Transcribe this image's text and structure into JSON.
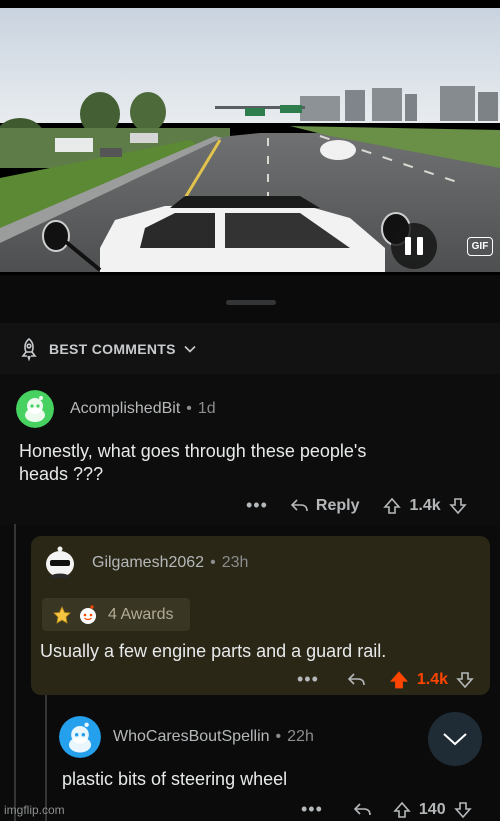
{
  "media": {
    "type": "gif",
    "gif_badge": "GIF",
    "pause_icon": "pause-icon"
  },
  "sort": {
    "label": "BEST COMMENTS",
    "icon": "rocket-icon"
  },
  "comments": [
    {
      "author": "AcomplishedBit",
      "age": "1d",
      "separator": "•",
      "body_line1": "Honestly, what goes through these people's",
      "body_line2": "heads ???",
      "more": "•••",
      "reply_label": "Reply",
      "score": "1.4k",
      "avatar_color": "#46d160"
    },
    {
      "author": "Gilgamesh2062",
      "age": "23h",
      "separator": "•",
      "awards_label": "4 Awards",
      "body": "Usually a few engine parts and a guard rail.",
      "more": "•••",
      "score": "1.4k",
      "upvoted": true,
      "upvote_color": "#ff4500",
      "score_color": "#ff4500"
    },
    {
      "author": "WhoCaresBoutSpellin",
      "age": "22h",
      "separator": "•",
      "body": "plastic bits of steering wheel",
      "more": "•••",
      "score": "140",
      "avatar_color": "#24a0ed"
    }
  ],
  "watermark": "imgflip.com",
  "colors": {
    "background": "#0b0b0b",
    "highlight_comment": "#2a2716",
    "accent_upvote": "#ff4500"
  }
}
